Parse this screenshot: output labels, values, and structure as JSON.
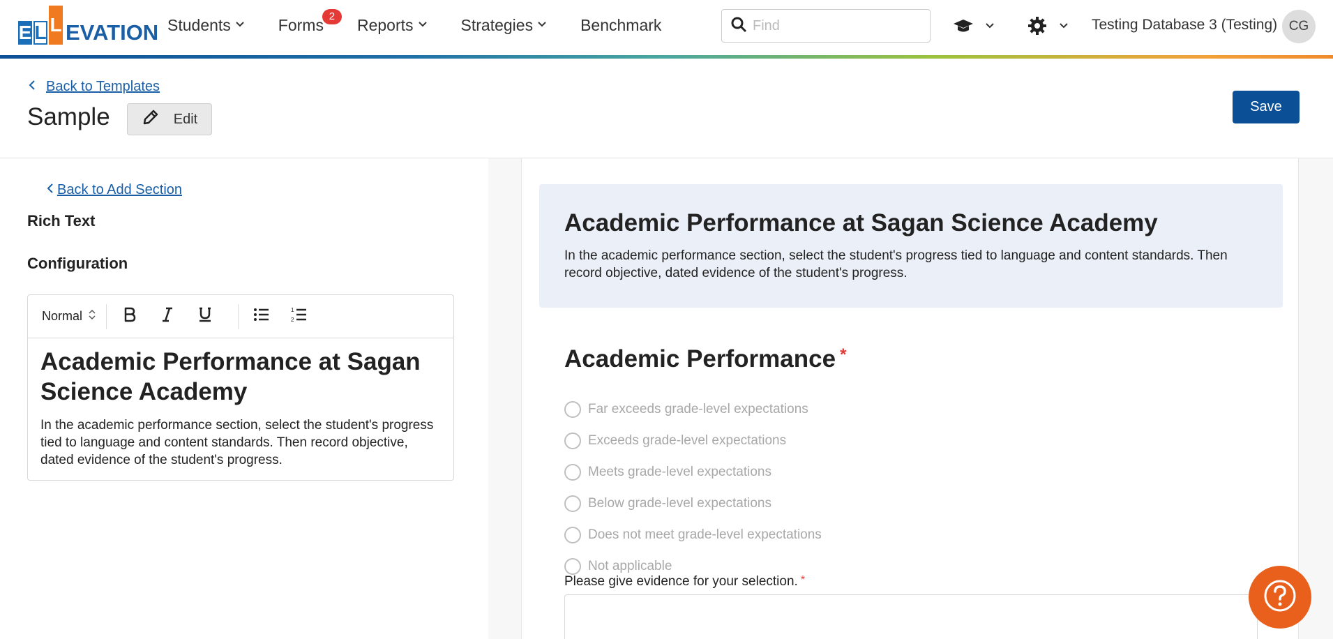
{
  "logo": {
    "letters": [
      "E",
      "L",
      "L"
    ],
    "rest": "EVATION"
  },
  "nav": {
    "students": "Students",
    "forms": "Forms",
    "forms_badge": "2",
    "reports": "Reports",
    "strategies": "Strategies",
    "benchmark": "Benchmark"
  },
  "search": {
    "placeholder": "Find"
  },
  "user": {
    "database": "Testing Database 3 (Testing)",
    "initials": "CG"
  },
  "header": {
    "back_label": "Back to Templates",
    "title": "Sample",
    "edit_label": "Edit",
    "save_label": "Save"
  },
  "left": {
    "back_label": "Back to Add Section",
    "section_type": "Rich Text",
    "config_label": "Configuration",
    "toolbar": {
      "format": "Normal"
    },
    "editor": {
      "heading": "Academic Performance at Sagan Science Academy",
      "paragraph": "In the academic performance section, select the student's progress tied to language and content standards. Then record objective, dated evidence of the student's progress."
    }
  },
  "preview": {
    "intro_title": "Academic Performance at Sagan Science Academy",
    "intro_text": "In the academic performance section, select the student's progress tied to language and content standards. Then record objective, dated evidence of the student's progress.",
    "question_title": "Academic Performance",
    "required_mark": "*",
    "options": [
      "Far exceeds grade-level expectations",
      "Exceeds grade-level expectations",
      "Meets grade-level expectations",
      "Below grade-level expectations",
      "Does not meet grade-level expectations",
      "Not applicable"
    ],
    "evidence_label": "Please give evidence for your selection."
  },
  "colors": {
    "brand": "#0b4f96",
    "accent": "#e8601c",
    "required": "#e53935",
    "card": "#ebf0f8"
  },
  "icons": [
    "search-icon",
    "graduation-cap-icon",
    "gear-icon",
    "chevron-down-icon",
    "chevron-left-icon",
    "pencil-icon",
    "bold-icon",
    "italic-icon",
    "underline-icon",
    "bullet-list-icon",
    "numbered-list-icon",
    "help-icon"
  ]
}
